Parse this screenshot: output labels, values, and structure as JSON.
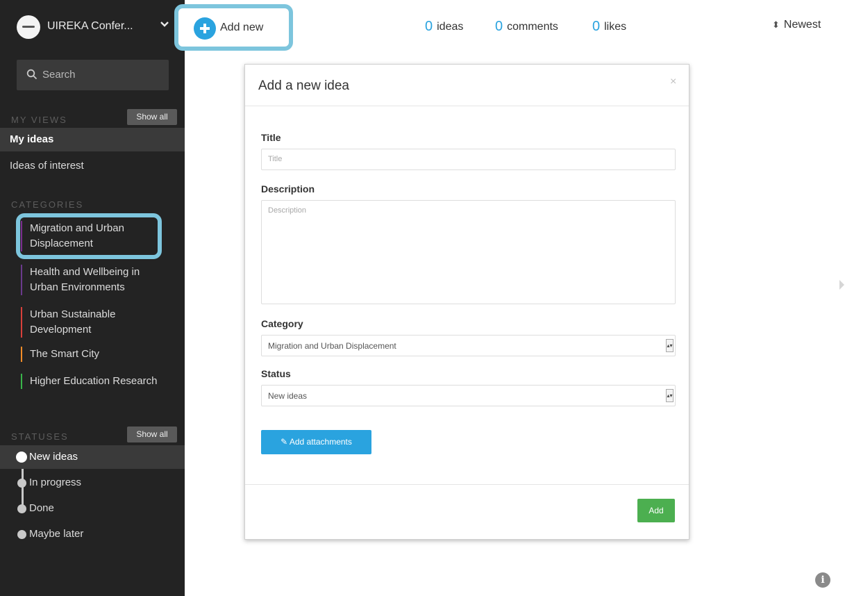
{
  "brand": {
    "name": "UIREKA Confer...",
    "logo_icon": "uireka-logo-icon"
  },
  "search": {
    "label": "Search"
  },
  "my_views": {
    "heading": "MY VIEWS",
    "show_all": "Show all",
    "items": [
      {
        "label": "My ideas",
        "active": true
      },
      {
        "label": "Ideas of interest",
        "active": false
      }
    ]
  },
  "categories": {
    "heading": "CATEGORIES",
    "items": [
      {
        "label": "Migration and Urban Displacement",
        "color": "#7b2f8f"
      },
      {
        "label": "Health and Wellbeing in Urban Environments",
        "color": "#6b3a8c"
      },
      {
        "label": "Urban Sustainable Development",
        "color": "#d9403b"
      },
      {
        "label": "The Smart City",
        "color": "#f28c28"
      },
      {
        "label": "Higher Education Research",
        "color": "#39b54a"
      }
    ]
  },
  "statuses": {
    "heading": "STATUSES",
    "show_all": "Show all",
    "items": [
      {
        "label": "New ideas",
        "active": true
      },
      {
        "label": "In progress",
        "active": false
      },
      {
        "label": "Done",
        "active": false
      },
      {
        "label": "Maybe later",
        "active": false
      }
    ]
  },
  "topbar": {
    "add_new": "Add new",
    "stats": [
      {
        "num": "0",
        "label": "ideas"
      },
      {
        "num": "0",
        "label": "comments"
      },
      {
        "num": "0",
        "label": "likes"
      }
    ],
    "sort": "Newest"
  },
  "modal": {
    "title": "Add a new idea",
    "close": "×",
    "title_label": "Title",
    "title_placeholder": "Title",
    "description_label": "Description",
    "description_placeholder": "Description",
    "category_label": "Category",
    "category_value": "Migration and Urban Displacement",
    "status_label": "Status",
    "status_value": "New ideas",
    "attach_label": "✎ Add attachments",
    "add_label": "Add"
  },
  "colors": {
    "accent": "#2aa3df",
    "highlight": "#7dc5dd",
    "success": "#4caf50",
    "sidebar_bg": "#232323"
  }
}
